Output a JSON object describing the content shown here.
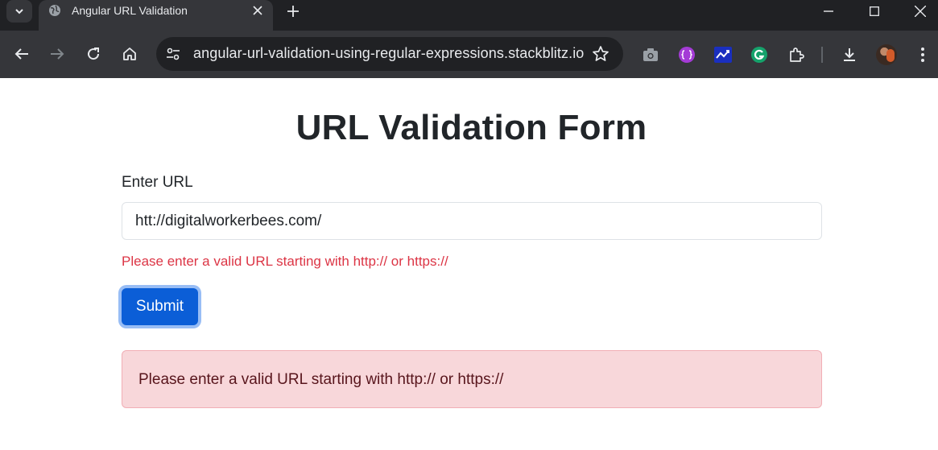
{
  "browser": {
    "tab": {
      "title": "Angular URL Validation"
    },
    "address_bar": {
      "url": "angular-url-validation-using-regular-expressions.stackblitz.io"
    },
    "icons": {
      "tab_search": "chevron-down-icon",
      "globe": "globe-icon",
      "close": "close-icon",
      "new_tab": "plus-icon",
      "back": "back-arrow-icon",
      "forward": "forward-arrow-icon",
      "reload": "reload-icon",
      "home": "home-icon",
      "site_info": "tune-icon",
      "bookmark": "star-icon",
      "extensions": [
        "camera-icon",
        "braces-extension-icon",
        "chart-extension-icon",
        "grammarly-icon",
        "puzzle-icon"
      ],
      "download": "download-icon",
      "menu": "kebab-menu-icon"
    },
    "colors": {
      "tabbar": "#202124",
      "toolbar": "#35363a"
    }
  },
  "page": {
    "title": "URL Validation Form",
    "form": {
      "url_label": "Enter URL",
      "url_value": "htt://digitalworkerbees.com/",
      "error_message": "Please enter a valid URL starting with http:// or https://",
      "submit_label": "Submit"
    },
    "alert": {
      "message": "Please enter a valid URL starting with http:// or https://"
    },
    "colors": {
      "primary": "#0b5ed7",
      "danger": "#dc3545",
      "alert_bg": "#f8d7da",
      "alert_text": "#58151c"
    }
  }
}
